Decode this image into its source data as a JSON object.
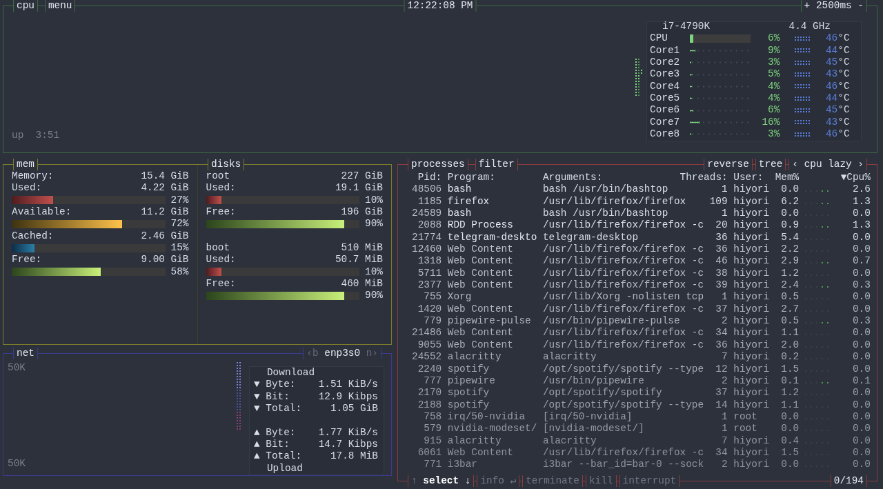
{
  "cpu_box": {
    "title": "cpu",
    "menu": "menu",
    "clock": "12:22:08 PM",
    "plus": "+",
    "interval": "2500ms",
    "minus": "-",
    "uptime": "up  3:51",
    "model": "i7-4790K",
    "freq": "4.4 GHz",
    "cores": [
      {
        "kind": "total",
        "name": "CPU",
        "level": 0.06,
        "percent": "6%",
        "temp": "46",
        "unit": "°C"
      },
      {
        "kind": "core",
        "name": "Core1",
        "level": 0.09,
        "percent": "9%",
        "temp": "44",
        "unit": "°C"
      },
      {
        "kind": "core",
        "name": "Core2",
        "level": 0.03,
        "percent": "3%",
        "temp": "45",
        "unit": "°C"
      },
      {
        "kind": "core",
        "name": "Core3",
        "level": 0.05,
        "percent": "5%",
        "temp": "43",
        "unit": "°C"
      },
      {
        "kind": "core",
        "name": "Core4",
        "level": 0.04,
        "percent": "4%",
        "temp": "46",
        "unit": "°C"
      },
      {
        "kind": "core",
        "name": "Core5",
        "level": 0.04,
        "percent": "4%",
        "temp": "44",
        "unit": "°C"
      },
      {
        "kind": "core",
        "name": "Core6",
        "level": 0.06,
        "percent": "6%",
        "temp": "45",
        "unit": "°C"
      },
      {
        "kind": "core",
        "name": "Core7",
        "level": 0.16,
        "percent": "16%",
        "temp": "43",
        "unit": "°C"
      },
      {
        "kind": "core",
        "name": "Core8",
        "level": 0.03,
        "percent": "3%",
        "temp": "46",
        "unit": "°C"
      }
    ]
  },
  "mem": {
    "title": "mem",
    "total_label": "Memory:",
    "total": "15.4 GiB",
    "items": [
      {
        "kind": "used",
        "label": "Used:",
        "value": "4.22 GiB",
        "level": 0.27,
        "percent": "27%"
      },
      {
        "kind": "available",
        "label": "Available:",
        "value": "11.2 GiB",
        "level": 0.72,
        "percent": "72%"
      },
      {
        "kind": "cached",
        "label": "Cached:",
        "value": "2.46 GiB",
        "level": 0.15,
        "percent": "15%"
      },
      {
        "kind": "free",
        "label": "Free:",
        "value": "9.00 GiB",
        "level": 0.58,
        "percent": "58%"
      }
    ]
  },
  "disks": {
    "title": "disks",
    "items": [
      {
        "name": "root",
        "size": "227 GiB",
        "stats": [
          {
            "kind": "used",
            "label": "Used:",
            "value": "19.1 GiB",
            "level": 0.1,
            "percent": "10%"
          },
          {
            "kind": "free",
            "label": "Free:",
            "value": "196 GiB",
            "level": 0.9,
            "percent": "90%"
          }
        ]
      },
      {
        "name": "boot",
        "size": "510 MiB",
        "stats": [
          {
            "kind": "used",
            "label": "Used:",
            "value": "50.7 MiB",
            "level": 0.1,
            "percent": "10%"
          },
          {
            "kind": "free",
            "label": "Free:",
            "value": "460 MiB",
            "level": 0.9,
            "percent": "90%"
          }
        ]
      }
    ]
  },
  "net": {
    "title": "net",
    "prev_key": "‹b",
    "interface": "enp3s0",
    "next_key": "n›",
    "scale_top": "50K",
    "scale_bottom": "50K",
    "download_title": "Download",
    "upload_title": "Upload",
    "download": [
      {
        "arrow": "▼",
        "label": "Byte:",
        "value": "1.51 KiB/s"
      },
      {
        "arrow": "▼",
        "label": "Bit:",
        "value": "12.9 Kibps"
      },
      {
        "arrow": "▼",
        "label": "Total:",
        "value": "1.05 GiB"
      }
    ],
    "upload": [
      {
        "arrow": "▲",
        "label": "Byte:",
        "value": "1.77 KiB/s"
      },
      {
        "arrow": "▲",
        "label": "Bit:",
        "value": "14.7 Kibps"
      },
      {
        "arrow": "▲",
        "label": "Total:",
        "value": "17.8 MiB"
      }
    ]
  },
  "processes": {
    "title": "processes",
    "filter": "filter",
    "reverse": "reverse",
    "tree": "tree",
    "sort_prev": "‹",
    "sort": "cpu lazy",
    "sort_next": "›",
    "columns": [
      "Pid:",
      "Program:",
      "Arguments:",
      "Threads:",
      "User:",
      "Mem%",
      "▼Cpu%"
    ],
    "rows": [
      {
        "pid": "48506",
        "program": "bash",
        "args": "bash /usr/bin/bashtop",
        "threads": "1",
        "user": "hiyori",
        "mem": "0.0",
        "cpu": "2.6"
      },
      {
        "pid": "1185",
        "program": "firefox",
        "args": "/usr/lib/firefox/firefox",
        "threads": "109",
        "user": "hiyori",
        "mem": "6.2",
        "cpu": "1.3"
      },
      {
        "pid": "24589",
        "program": "bash",
        "args": "bash /usr/bin/bashtop",
        "threads": "1",
        "user": "hiyori",
        "mem": "0.0",
        "cpu": "0.0"
      },
      {
        "pid": "2088",
        "program": "RDD Process",
        "args": "/usr/lib/firefox/firefox -c",
        "threads": "20",
        "user": "hiyori",
        "mem": "0.9",
        "cpu": "1.3"
      },
      {
        "pid": "21774",
        "program": "telegram-deskto",
        "args": "telegram-desktop",
        "threads": "36",
        "user": "hiyori",
        "mem": "5.4",
        "cpu": "0.0"
      },
      {
        "pid": "12460",
        "program": "Web Content",
        "args": "/usr/lib/firefox/firefox -c",
        "threads": "36",
        "user": "hiyori",
        "mem": "2.2",
        "cpu": "0.0"
      },
      {
        "pid": "1318",
        "program": "Web Content",
        "args": "/usr/lib/firefox/firefox -c",
        "threads": "46",
        "user": "hiyori",
        "mem": "2.9",
        "cpu": "0.7"
      },
      {
        "pid": "5711",
        "program": "Web Content",
        "args": "/usr/lib/firefox/firefox -c",
        "threads": "38",
        "user": "hiyori",
        "mem": "1.2",
        "cpu": "0.0"
      },
      {
        "pid": "2377",
        "program": "Web Content",
        "args": "/usr/lib/firefox/firefox -c",
        "threads": "39",
        "user": "hiyori",
        "mem": "2.4",
        "cpu": "0.3"
      },
      {
        "pid": "755",
        "program": "Xorg",
        "args": "/usr/lib/Xorg -nolisten tcp",
        "threads": "1",
        "user": "hiyori",
        "mem": "0.5",
        "cpu": "0.0"
      },
      {
        "pid": "1420",
        "program": "Web Content",
        "args": "/usr/lib/firefox/firefox -c",
        "threads": "37",
        "user": "hiyori",
        "mem": "2.7",
        "cpu": "0.0"
      },
      {
        "pid": "779",
        "program": "pipewire-pulse",
        "args": "/usr/bin/pipewire-pulse",
        "threads": "2",
        "user": "hiyori",
        "mem": "0.5",
        "cpu": "0.3"
      },
      {
        "pid": "21486",
        "program": "Web Content",
        "args": "/usr/lib/firefox/firefox -c",
        "threads": "34",
        "user": "hiyori",
        "mem": "1.1",
        "cpu": "0.0"
      },
      {
        "pid": "9055",
        "program": "Web Content",
        "args": "/usr/lib/firefox/firefox -c",
        "threads": "36",
        "user": "hiyori",
        "mem": "2.0",
        "cpu": "0.0"
      },
      {
        "pid": "24552",
        "program": "alacritty",
        "args": "alacritty",
        "threads": "7",
        "user": "hiyori",
        "mem": "0.2",
        "cpu": "0.0"
      },
      {
        "pid": "2240",
        "program": "spotify",
        "args": "/opt/spotify/spotify --type",
        "threads": "12",
        "user": "hiyori",
        "mem": "1.5",
        "cpu": "0.0"
      },
      {
        "pid": "777",
        "program": "pipewire",
        "args": "/usr/bin/pipewire",
        "threads": "2",
        "user": "hiyori",
        "mem": "0.1",
        "cpu": "0.1"
      },
      {
        "pid": "2170",
        "program": "spotify",
        "args": "/opt/spotify/spotify",
        "threads": "37",
        "user": "hiyori",
        "mem": "1.2",
        "cpu": "0.0"
      },
      {
        "pid": "2188",
        "program": "spotify",
        "args": "/opt/spotify/spotify --type",
        "threads": "14",
        "user": "hiyori",
        "mem": "1.1",
        "cpu": "0.0"
      },
      {
        "pid": "758",
        "program": "irq/50-nvidia",
        "args": "[irq/50-nvidia]",
        "threads": "1",
        "user": "root",
        "mem": "0.0",
        "cpu": "0.0"
      },
      {
        "pid": "579",
        "program": "nvidia-modeset/",
        "args": "[nvidia-modeset/]",
        "threads": "1",
        "user": "root",
        "mem": "0.0",
        "cpu": "0.0"
      },
      {
        "pid": "915",
        "program": "alacritty",
        "args": "alacritty",
        "threads": "7",
        "user": "hiyori",
        "mem": "0.4",
        "cpu": "0.0"
      },
      {
        "pid": "6061",
        "program": "Web Content",
        "args": "/usr/lib/firefox/firefox -c",
        "threads": "34",
        "user": "hiyori",
        "mem": "1.5",
        "cpu": "0.0"
      },
      {
        "pid": "771",
        "program": "i3bar",
        "args": "i3bar --bar_id=bar-0 --sock",
        "threads": "2",
        "user": "hiyori",
        "mem": "0.0",
        "cpu": "0.0"
      }
    ],
    "footer": [
      {
        "prefix": "↑",
        "label": "select ↓",
        "disabled": false
      },
      {
        "label": "info ↵",
        "disabled": true
      },
      {
        "label": "terminate",
        "disabled": true
      },
      {
        "label": "kill",
        "disabled": true
      },
      {
        "label": "interrupt",
        "disabled": true
      }
    ],
    "count": "0/194"
  }
}
